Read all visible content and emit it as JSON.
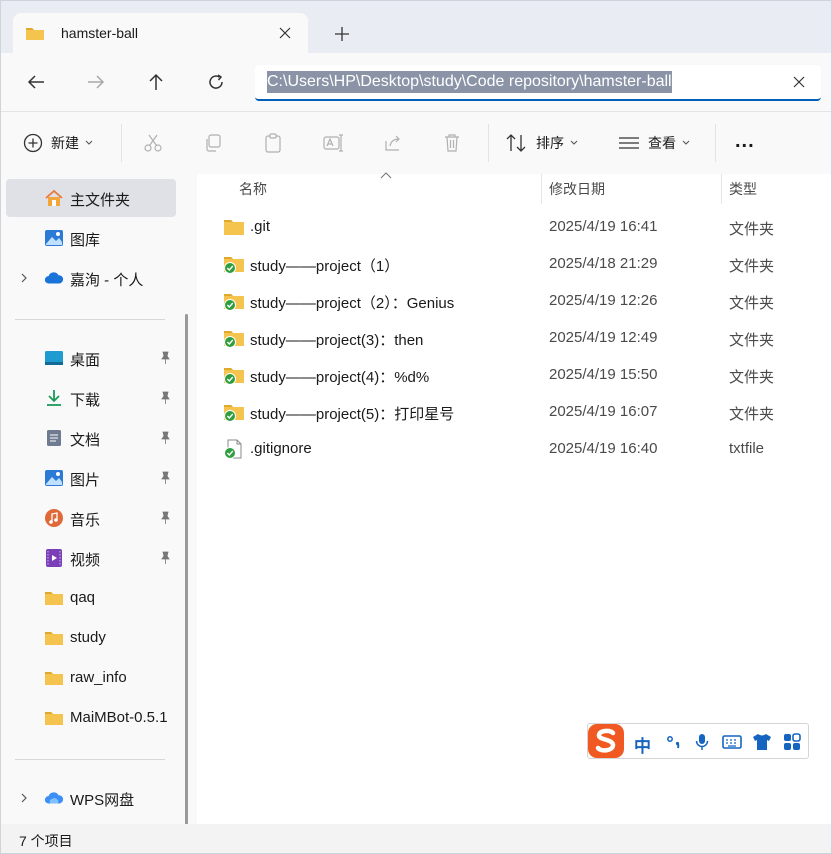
{
  "window": {
    "tab_title": "hamster-ball"
  },
  "nav": {
    "address": "C:\\Users\\HP\\Desktop\\study\\Code repository\\hamster-ball"
  },
  "toolbar": {
    "new_label": "新建",
    "sort_label": "排序",
    "view_label": "查看",
    "more_label": "..."
  },
  "sidebar": {
    "items": [
      {
        "label": "主文件夹",
        "icon": "home-icon"
      },
      {
        "label": "图库",
        "icon": "gallery-icon"
      },
      {
        "label": "嘉洵 - 个人",
        "icon": "onedrive-cloud-icon"
      },
      {
        "label": "桌面",
        "icon": "desktop-icon"
      },
      {
        "label": "下载",
        "icon": "download-icon"
      },
      {
        "label": "文档",
        "icon": "document-icon"
      },
      {
        "label": "图片",
        "icon": "pictures-icon"
      },
      {
        "label": "音乐",
        "icon": "music-icon"
      },
      {
        "label": "视频",
        "icon": "video-icon"
      },
      {
        "label": "qaq",
        "icon": "folder-icon"
      },
      {
        "label": "study",
        "icon": "folder-icon"
      },
      {
        "label": "raw_info",
        "icon": "folder-icon"
      },
      {
        "label": "MaiMBot-0.5.1",
        "icon": "folder-icon"
      },
      {
        "label": "WPS网盘",
        "icon": "wps-cloud-icon"
      }
    ]
  },
  "columns": {
    "name": "名称",
    "date": "修改日期",
    "type": "类型"
  },
  "files": [
    {
      "name": ".git",
      "date": "2025/4/19 16:41",
      "type": "文件夹",
      "icon": "folder-icon"
    },
    {
      "name": "study——project（1）",
      "date": "2025/4/18 21:29",
      "type": "文件夹",
      "icon": "folder-synced-icon"
    },
    {
      "name": "study——project（2）：Genius",
      "date": "2025/4/19 12:26",
      "type": "文件夹",
      "icon": "folder-synced-icon"
    },
    {
      "name": "study——project(3)：then",
      "date": "2025/4/19 12:49",
      "type": "文件夹",
      "icon": "folder-synced-icon"
    },
    {
      "name": "study——project(4)：%d%",
      "date": "2025/4/19 15:50",
      "type": "文件夹",
      "icon": "folder-synced-icon"
    },
    {
      "name": "study——project(5)：打印星号",
      "date": "2025/4/19 16:07",
      "type": "文件夹",
      "icon": "folder-synced-icon"
    },
    {
      "name": ".gitignore",
      "date": "2025/4/19 16:40",
      "type": "txtfile",
      "icon": "file-synced-icon"
    }
  ],
  "ime": {
    "mode_label": "中"
  },
  "status": {
    "item_count": "7 个项目"
  },
  "colors": {
    "accent": "#005fb8",
    "folder": "#f5c44e",
    "sync_ok": "#2e9e3e"
  }
}
